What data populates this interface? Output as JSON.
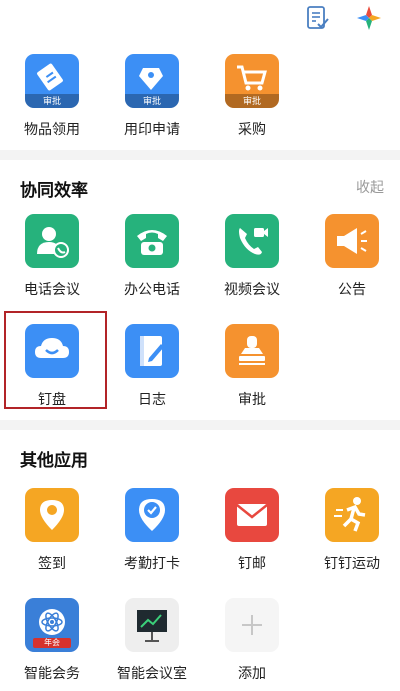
{
  "top_icons": [
    {
      "icon": "document-check-icon"
    },
    {
      "icon": "dingtalk-logo-icon"
    }
  ],
  "badge_text": "审批",
  "row1": [
    {
      "label": "物品领用",
      "icon": "item-request-icon",
      "color": "#3c8ff5"
    },
    {
      "label": "用印申请",
      "icon": "seal-request-icon",
      "color": "#3c8ff5"
    },
    {
      "label": "采购",
      "icon": "purchase-cart-icon",
      "color": "#f5922f"
    }
  ],
  "section1": {
    "title": "协同效率",
    "collapse_label": "收起",
    "apps": [
      {
        "label": "电话会议",
        "icon": "phone-meeting-icon",
        "color": "#26b27c"
      },
      {
        "label": "办公电话",
        "icon": "office-phone-icon",
        "color": "#26b27c"
      },
      {
        "label": "视频会议",
        "icon": "video-meeting-icon",
        "color": "#26b27c"
      },
      {
        "label": "公告",
        "icon": "announcement-icon",
        "color": "#f5922f"
      },
      {
        "label": "钉盘",
        "icon": "cloud-drive-icon",
        "color": "#3c8ff5"
      },
      {
        "label": "日志",
        "icon": "journal-icon",
        "color": "#3c8ff5"
      },
      {
        "label": "审批",
        "icon": "approval-stamp-icon",
        "color": "#f5922f"
      }
    ]
  },
  "section2": {
    "title": "其他应用",
    "apps": [
      {
        "label": "签到",
        "icon": "check-in-icon",
        "color": "#f5a623"
      },
      {
        "label": "考勤打卡",
        "icon": "attendance-icon",
        "color": "#3c8ff5"
      },
      {
        "label": "钉邮",
        "icon": "mail-icon",
        "color": "#e8483f"
      },
      {
        "label": "钉钉运动",
        "icon": "sport-run-icon",
        "color": "#f5a623"
      },
      {
        "label": "智能会务",
        "icon": "smart-conference-icon",
        "color": "#3a7fd8"
      },
      {
        "label": "智能会议室",
        "icon": "smart-meeting-room-icon",
        "color": "#eeeeee"
      },
      {
        "label": "添加",
        "icon": "add-icon",
        "color": "#f5f5f5"
      }
    ],
    "conference_badge_text": "年会"
  }
}
